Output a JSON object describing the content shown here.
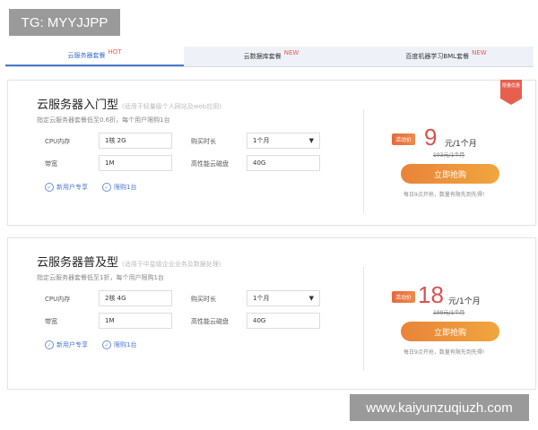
{
  "watermark_top": "TG: MYYJJPP",
  "watermark_bottom": "www.kaiyunzuqiuzh.com",
  "tabs": [
    {
      "label": "云服务器套餐",
      "badge": "HOT"
    },
    {
      "label": "云数据库套餐",
      "badge": "NEW"
    },
    {
      "label": "百度机器学习BML套餐",
      "badge": "NEW"
    }
  ],
  "ribbon": "限量优惠",
  "cards": [
    {
      "title": "云服务器入门型",
      "subtitle": "(适用于轻量级个人网站及web应用)",
      "desc": "指定云服务器套餐低至0.6折，每个用户限购1台",
      "cpu_label": "CPU内存",
      "cpu_value": "1核 2G",
      "duration_label": "购买时长",
      "duration_value": "1个月",
      "bandwidth_label": "带宽",
      "bandwidth_value": "1M",
      "disk_label": "高性能云磁盘",
      "disk_value": "40G",
      "badge1": "新用户专享",
      "badge2": "限购1台",
      "tag": "活动价",
      "price": "9",
      "unit": "元/1个月",
      "original": "103元/1个月",
      "button": "立即抢购",
      "note": "每日9点开抢，数量有限先到先得!"
    },
    {
      "title": "云服务器普及型",
      "subtitle": "(适用于中星级企业业务及数据处理)",
      "desc": "指定云服务器套餐低至1折，每个用户限购1台",
      "cpu_label": "CPU内存",
      "cpu_value": "2核 4G",
      "duration_label": "购买时长",
      "duration_value": "1个月",
      "bandwidth_label": "带宽",
      "bandwidth_value": "1M",
      "disk_label": "高性能云磁盘",
      "disk_value": "40G",
      "badge1": "新用户专享",
      "badge2": "限购1台",
      "tag": "活动价",
      "price": "18",
      "unit": "元/1个月",
      "original": "199元/1个月",
      "button": "立即抢购",
      "note": "每日9点开抢，数量有限先到先得!"
    }
  ]
}
